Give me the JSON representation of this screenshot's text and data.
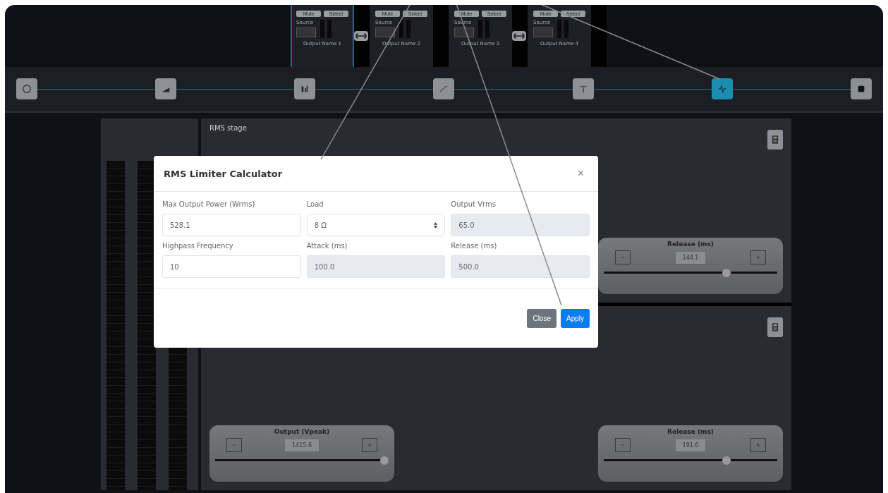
{
  "channels": [
    {
      "mute": "Mute",
      "select": "Select",
      "source_label": "Source",
      "name": "Output Name 1",
      "selected": true,
      "linked_next": true
    },
    {
      "mute": "Mute",
      "select": "Select",
      "source_label": "Source",
      "name": "Output Name 2",
      "selected": false,
      "linked_next": false
    },
    {
      "mute": "Mute",
      "select": "Select",
      "source_label": "Source",
      "name": "Output Name 3",
      "selected": false,
      "linked_next": true
    },
    {
      "mute": "Mute",
      "select": "Select",
      "source_label": "Source",
      "name": "Output Name 4",
      "selected": false,
      "linked_next": false
    }
  ],
  "nav": [
    {
      "selected": false
    },
    {
      "selected": false
    },
    {
      "selected": false
    },
    {
      "selected": false
    },
    {
      "selected": false
    },
    {
      "selected": true
    },
    {
      "selected": false
    }
  ],
  "stages": [
    {
      "title": "RMS stage",
      "right_control": {
        "label": "Release (ms)",
        "value": "144.1",
        "level": 0.72
      }
    },
    {
      "left_control": {
        "label": "Output (Vpeak)",
        "value": "1415.6",
        "level": 1.0
      },
      "right_control": {
        "label": "Release (ms)",
        "value": "191.6",
        "level": 0.72
      }
    }
  ],
  "dialog": {
    "title": "RMS Limiter Calculator",
    "close": "×",
    "fields": [
      {
        "kind": "input",
        "label": "Max Output Power (Wrms)",
        "value": "528.1"
      },
      {
        "kind": "select",
        "label": "Load",
        "value": "8 Ω"
      },
      {
        "kind": "readonly",
        "label": "Output Vrms",
        "value": "65.0"
      },
      {
        "kind": "input",
        "label": "Highpass Frequency",
        "value": "10"
      },
      {
        "kind": "readonly",
        "label": "Attack (ms)",
        "value": "100.0"
      },
      {
        "kind": "readonly",
        "label": "Release (ms)",
        "value": "500.0"
      }
    ],
    "buttons": [
      {
        "kind": "secondary",
        "label": "Close"
      },
      {
        "kind": "primary",
        "label": "Apply"
      }
    ]
  }
}
